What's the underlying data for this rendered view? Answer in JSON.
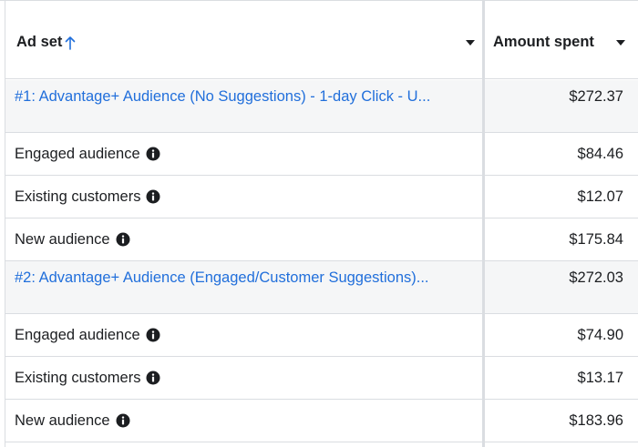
{
  "header": {
    "ad_set_label": "Ad set",
    "amount_label": "Amount spent",
    "sort_icon": "arrow-up-icon",
    "dropdown_icon": "caret-down-icon"
  },
  "colors": {
    "link": "#216fdb",
    "group_bg": "#f5f6f7",
    "border": "#dadde1",
    "text": "#1c1e21"
  },
  "rows": [
    {
      "type": "group",
      "label": "#1: Advantage+ Audience (No Suggestions) - 1-day Click - U...",
      "amount": "$272.37"
    },
    {
      "type": "sub",
      "label": "Engaged audience",
      "amount": "$84.46",
      "icon": "info-icon"
    },
    {
      "type": "sub",
      "label": "Existing customers",
      "amount": "$12.07",
      "icon": "info-icon"
    },
    {
      "type": "sub",
      "label": "New audience",
      "amount": "$175.84",
      "icon": "info-icon"
    },
    {
      "type": "group",
      "label": "#2: Advantage+ Audience (Engaged/Customer Suggestions)...",
      "amount": "$272.03"
    },
    {
      "type": "sub",
      "label": "Engaged audience",
      "amount": "$74.90",
      "icon": "info-icon"
    },
    {
      "type": "sub",
      "label": "Existing customers",
      "amount": "$13.17",
      "icon": "info-icon"
    },
    {
      "type": "sub",
      "label": "New audience",
      "amount": "$183.96",
      "icon": "info-icon"
    }
  ]
}
